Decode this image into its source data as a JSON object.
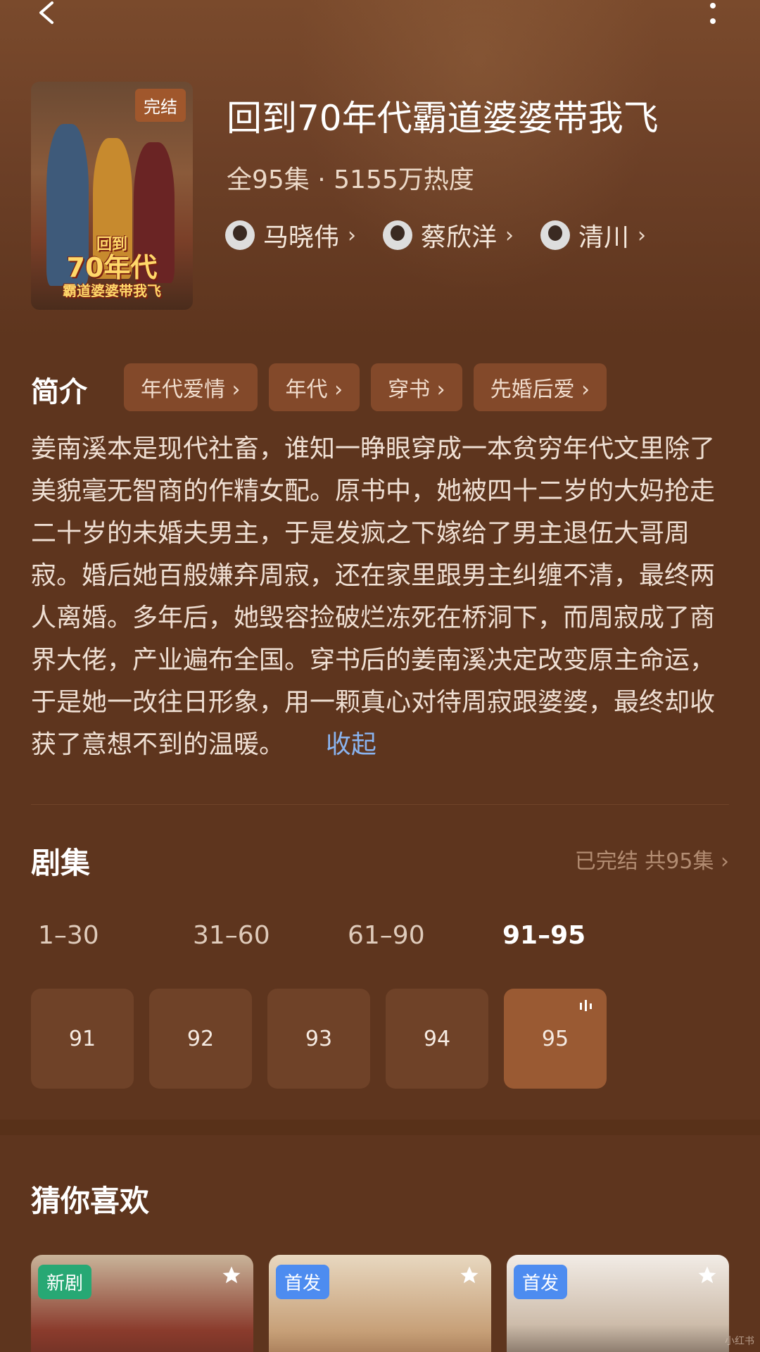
{
  "colors": {
    "background": "#5e351e",
    "tag_bg": "#83492a",
    "episode_bg": "#6f4228",
    "episode_active_bg": "#9a5a33",
    "link": "#8ab4f0",
    "badge_new": "#27a874",
    "badge_first": "#4d8cf0"
  },
  "nav": {
    "back_icon": "chevron-left-icon",
    "more_icon": "more-vertical-icon"
  },
  "show": {
    "cover_badge": "完结",
    "poster_title_line1": "回到",
    "poster_title_line2": "70年代",
    "poster_title_line3": "霸道婆婆带我飞",
    "title": "回到70年代霸道婆婆带我飞",
    "meta": "全95集 · 5155万热度",
    "cast": [
      {
        "name": "马晓伟"
      },
      {
        "name": "蔡欣洋"
      },
      {
        "name": "清川"
      }
    ]
  },
  "intro": {
    "label": "简介",
    "tags": [
      "年代爱情 ›",
      "年代 ›",
      "穿书 ›",
      "先婚后爱 ›"
    ],
    "synopsis": "姜南溪本是现代社畜，谁知一睁眼穿成一本贫穷年代文里除了美貌毫无智商的作精女配。原书中，她被四十二岁的大妈抢走二十岁的未婚夫男主，于是发疯之下嫁给了男主退伍大哥周寂。婚后她百般嫌弃周寂，还在家里跟男主纠缠不清，最终两人离婚。多年后，她毁容捡破烂冻死在桥洞下，而周寂成了商界大佬，产业遍布全国。穿书后的姜南溪决定改变原主命运，于是她一改往日形象，用一颗真心对待周寂跟婆婆，最终却收获了意想不到的温暖。",
    "collapse": "收起"
  },
  "episodes": {
    "label": "剧集",
    "status": "已完结 共95集 ›",
    "ranges": [
      "1–30",
      "31–60",
      "61–90",
      "91–95"
    ],
    "active_range": "91–95",
    "items": [
      "91",
      "92",
      "93",
      "94",
      "95"
    ],
    "active_episode": "95"
  },
  "recommend": {
    "label": "猜你喜欢",
    "cards": [
      {
        "badge": "新剧"
      },
      {
        "badge": "首发"
      },
      {
        "badge": "首发"
      }
    ]
  },
  "watermark": "小红书"
}
